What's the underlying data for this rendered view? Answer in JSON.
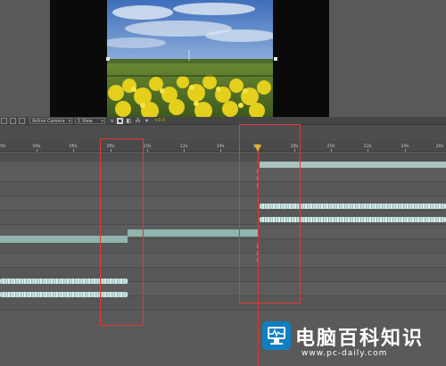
{
  "viewer_toolbar": {
    "camera_select": "Active Camera",
    "view_select": "1 View",
    "exposure_value": "+0.0"
  },
  "ruler": {
    "labels": [
      "00s",
      "04s",
      "06s",
      "08s",
      "10s",
      "12s",
      "14s",
      "16s",
      "18s",
      "20s",
      "22s",
      "24s",
      "26s"
    ]
  },
  "watermark": {
    "title": "电脑百科知识",
    "url": "www.pc-daily.com"
  },
  "colors": {
    "highlight_box": "#e03838",
    "playhead": "#d73a2e",
    "playhead_head": "#e8b12c",
    "layer_bar": "#8fb5ae",
    "brand": "#0d7fc2"
  },
  "icons": [
    "render-icon",
    "grid-icon",
    "fast-preview-icon",
    "reset-exposure-icon",
    "keyframe-icon",
    "monitor-icon"
  ]
}
